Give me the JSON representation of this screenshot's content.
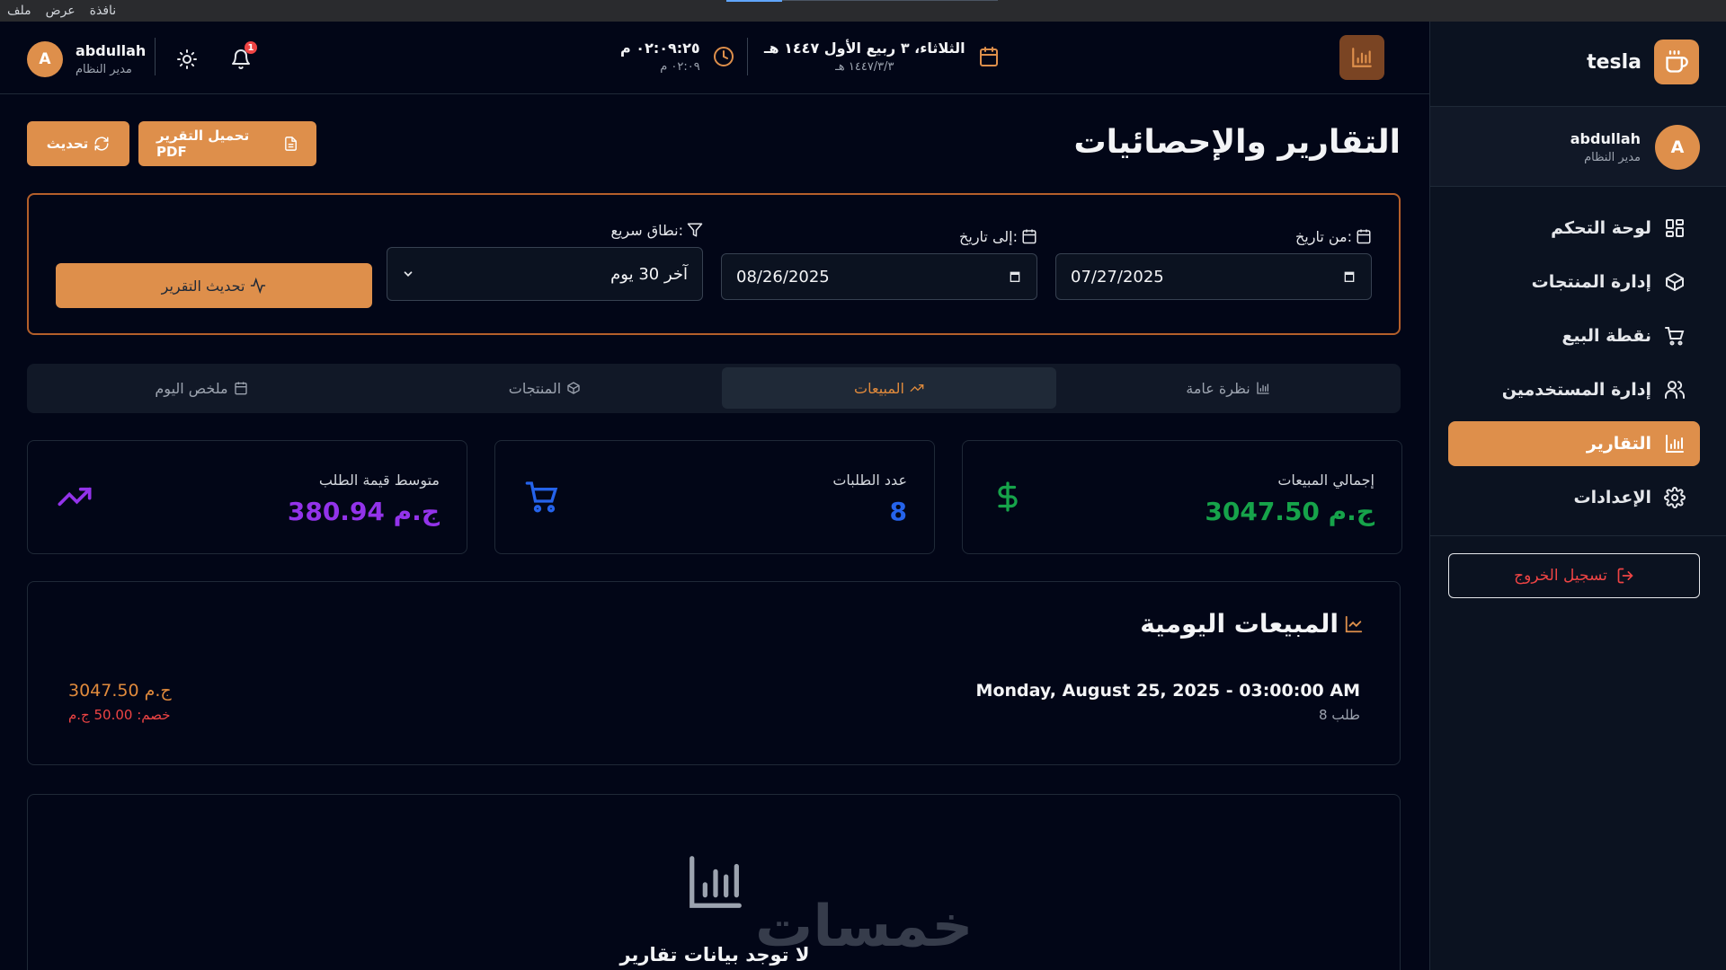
{
  "menubar": {
    "items": [
      "ملف",
      "عرض",
      "نافذة"
    ]
  },
  "header": {
    "user": {
      "initial": "A",
      "name": "abdullah",
      "role": "مدير النظام"
    },
    "notifications_count": "1",
    "time_main": "٠٢:٠٩:٢٥ م",
    "time_sub": "٠٢:٠٩ م",
    "date_main": "الثلاثاء، ٣ ربيع الأول ١٤٤٧ هـ",
    "date_sub": "١٤٤٧/٣/٣ هـ"
  },
  "sidebar": {
    "brand": "tesla",
    "user": {
      "initial": "A",
      "name": "abdullah",
      "role": "مدير النظام"
    },
    "items": [
      {
        "label": "لوحة التحكم",
        "icon": "grid-icon"
      },
      {
        "label": "إدارة المنتجات",
        "icon": "box-icon"
      },
      {
        "label": "نقطة البيع",
        "icon": "cart-icon"
      },
      {
        "label": "إدارة المستخدمين",
        "icon": "users-icon"
      },
      {
        "label": "التقارير",
        "icon": "bar-chart-icon",
        "active": true
      },
      {
        "label": "الإعدادات",
        "icon": "gear-icon"
      }
    ],
    "logout": "تسجيل الخروج"
  },
  "page": {
    "title": "التقارير والإحصائيات",
    "download_pdf": "تحميل التقرير PDF",
    "refresh": "تحديث"
  },
  "filters": {
    "from_label": "من تاريخ:",
    "from_value": "07/27/2025",
    "to_label": "إلى تاريخ:",
    "to_value": "08/26/2025",
    "range_label": "نطاق سريع:",
    "range_value": "آخر 30 يوم",
    "update_button": "تحديث التقرير"
  },
  "tabs": [
    {
      "label": "نظرة عامة"
    },
    {
      "label": "المبيعات",
      "active": true
    },
    {
      "label": "المنتجات"
    },
    {
      "label": "ملخص اليوم"
    }
  ],
  "stats": {
    "total_sales": {
      "label": "إجمالي المبيعات",
      "value": "3047.50 ج.م",
      "color": "#16a34a"
    },
    "orders": {
      "label": "عدد الطلبات",
      "value": "8",
      "color": "#2563eb"
    },
    "avg_order": {
      "label": "متوسط قيمة الطلب",
      "value": "380.94 ج.م",
      "color": "#9333ea"
    }
  },
  "daily_sales": {
    "title": "المبيعات اليومية",
    "row": {
      "date": "Monday, August 25, 2025 - 03:00:00 AM",
      "orders": "8 طلب",
      "amount": "3047.50 ج.م",
      "discount": "خصم: 50.00 ج.م"
    }
  },
  "empty_state": {
    "text": "لا توجد بيانات تقارير"
  },
  "watermark": "خمسات",
  "colors": {
    "accent": "#de8f4b",
    "background": "#020617",
    "danger": "#ef4444"
  }
}
